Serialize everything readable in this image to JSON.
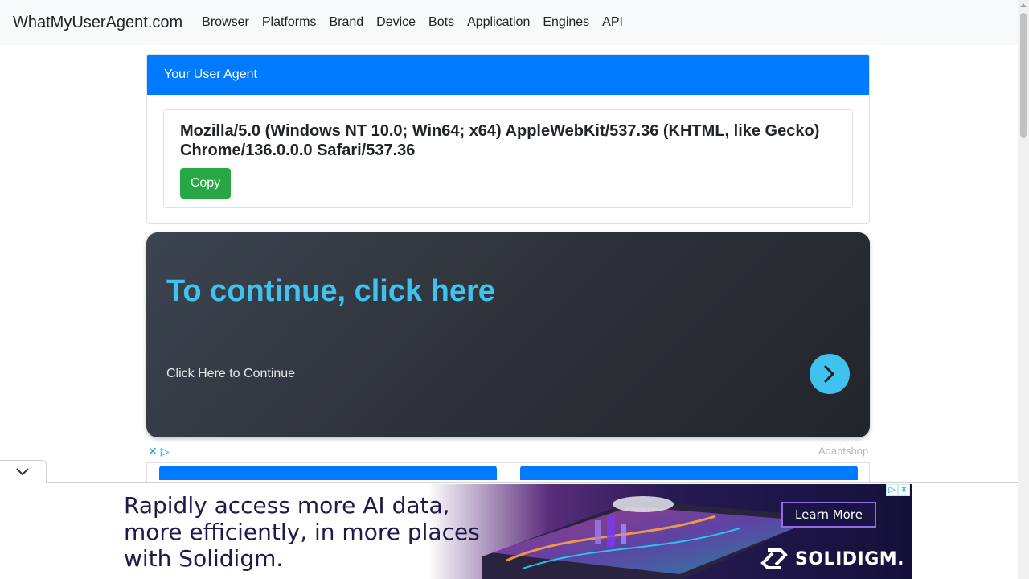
{
  "navbar": {
    "brand": "WhatMyUserAgent.com",
    "links": [
      "Browser",
      "Platforms",
      "Brand",
      "Device",
      "Bots",
      "Application",
      "Engines",
      "API"
    ]
  },
  "card": {
    "header": "Your User Agent",
    "user_agent": "Mozilla/5.0 (Windows NT 10.0; Win64; x64) AppleWebKit/537.36 (KHTML, like Gecko) Chrome/136.0.0.0 Safari/537.36",
    "copy_label": "Copy"
  },
  "ad": {
    "headline": "To continue, click here",
    "subtext": "Click Here to Continue",
    "source": "Adaptshop",
    "choices_close": "✕",
    "choices_play": "▷"
  },
  "banner": {
    "line1": "Rapidly access more AI data,",
    "line2": "more efficiently, in more places",
    "line3": "with Solidigm.",
    "cta": "Learn More",
    "logo": "SOLIDIGM."
  },
  "colors": {
    "primary": "#007bff",
    "success": "#28a745",
    "ad_accent": "#3fc3ee"
  }
}
